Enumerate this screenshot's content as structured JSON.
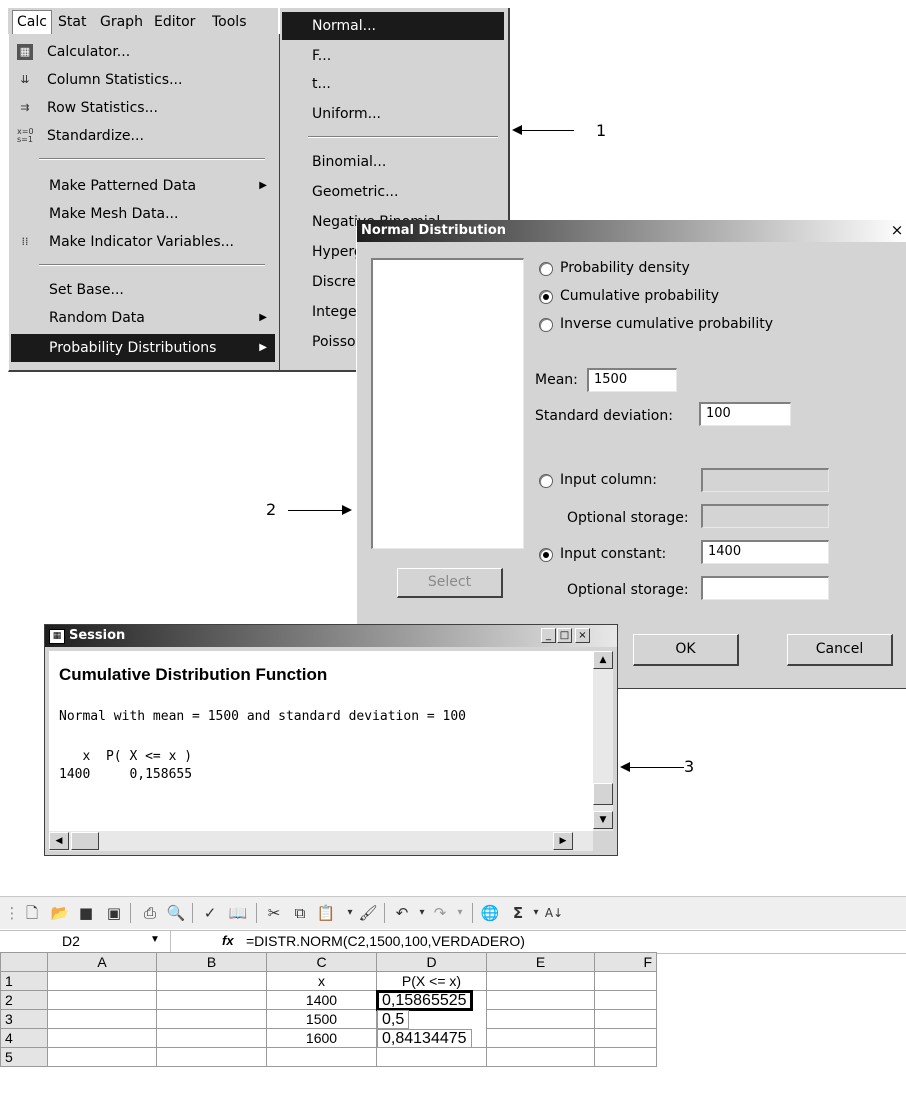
{
  "menubar": {
    "items": [
      {
        "label": "Calc",
        "key": "C"
      },
      {
        "label": "Stat",
        "key": "S"
      },
      {
        "label": "Graph",
        "key": "G"
      },
      {
        "label": "Editor",
        "key": "d"
      },
      {
        "label": "Tools",
        "key": "T"
      }
    ]
  },
  "calc_menu": {
    "items": [
      {
        "label": "Calculator...",
        "icon": "calculator-icon"
      },
      {
        "label": "Column Statistics...",
        "icon": "column-stats-icon"
      },
      {
        "label": "Row Statistics...",
        "icon": "row-stats-icon"
      },
      {
        "label": "Standardize...",
        "icon": "standardize-icon"
      },
      {
        "label": "Make Patterned Data"
      },
      {
        "label": "Make Mesh Data..."
      },
      {
        "label": "Make Indicator Variables...",
        "icon": "indicator-icon"
      },
      {
        "label": "Set Base..."
      },
      {
        "label": "Random Data"
      },
      {
        "label": "Probability Distributions",
        "selected": true
      }
    ]
  },
  "dist_submenu": {
    "items": [
      "Normal...",
      "F...",
      "t...",
      "Uniform...",
      "Binomial...",
      "Geometric...",
      "Negative Binomial...",
      "Hypergeometric...",
      "Discrete...",
      "Integer...",
      "Poisson..."
    ]
  },
  "normal_dialog": {
    "title": "Normal Distribution",
    "close": "×",
    "radio_pdf": "Probability density",
    "radio_cdf": "Cumulative probability",
    "radio_inv": "Inverse cumulative probability",
    "mean_label": "Mean:",
    "mean_value": "1500",
    "sd_label": "Standard deviation:",
    "sd_value": "100",
    "input_column_label": "Input column:",
    "optional_storage_1": "Optional storage:",
    "input_constant_label": "Input constant:",
    "input_constant_value": "1400",
    "optional_storage_2": "Optional storage:",
    "select_button": "Select",
    "ok_button": "OK",
    "cancel_button": "Cancel"
  },
  "session": {
    "title": "Session",
    "heading": "Cumulative Distribution Function",
    "line1": "Normal with mean = 1500 and standard deviation = 100",
    "header": "   x  P( X <= x )",
    "row": "1400     0,158655"
  },
  "annotations": {
    "a1": "1",
    "a2": "2",
    "a3": "3"
  },
  "spreadsheet": {
    "name_box": "D2",
    "fx": "fx",
    "formula": "=DISTR.NORM(C2,1500,100,VERDADERO)",
    "columns": [
      "A",
      "B",
      "C",
      "D",
      "E",
      "F"
    ],
    "rows": [
      {
        "n": "1",
        "c": "x",
        "d": "P(X <= x)"
      },
      {
        "n": "2",
        "c": "1400",
        "d": "0,15865525"
      },
      {
        "n": "3",
        "c": "1500",
        "d": "0,5"
      },
      {
        "n": "4",
        "c": "1600",
        "d": "0,84134475"
      },
      {
        "n": "5",
        "c": "",
        "d": ""
      }
    ]
  }
}
